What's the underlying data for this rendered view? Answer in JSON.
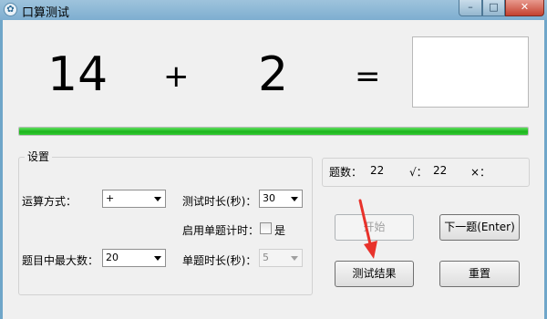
{
  "window": {
    "title": "口算测试",
    "icon_glyph": "✿"
  },
  "titlebar_buttons": {
    "min": "–",
    "max": "□",
    "close": "✕"
  },
  "question": {
    "operand1": "14",
    "operator": "+",
    "operand2": "2",
    "equals": "=",
    "answer": ""
  },
  "progress": {
    "fraction": 1.0
  },
  "settings": {
    "title": "设置",
    "operation_label": "运算方式：",
    "operation_value": "+",
    "max_number_label": "题目中最大数：",
    "max_number_value": "20",
    "duration_label": "测试时长(秒)：",
    "duration_value": "30",
    "per_question_timer_label": "启用单题计时：",
    "per_question_timer_option": "是",
    "per_question_duration_label": "单题时长(秒)：",
    "per_question_duration_value": "5"
  },
  "stats": {
    "count_label": "题数：",
    "count_value": "22",
    "correct_label": "√：",
    "correct_value": "22",
    "wrong_label": "×："
  },
  "buttons": {
    "start": "开始",
    "next": "下一题(Enter)",
    "results": "测试结果",
    "reset": "重置"
  },
  "colors": {
    "progress": "#1db51d",
    "annotation_arrow": "#e8322b"
  }
}
